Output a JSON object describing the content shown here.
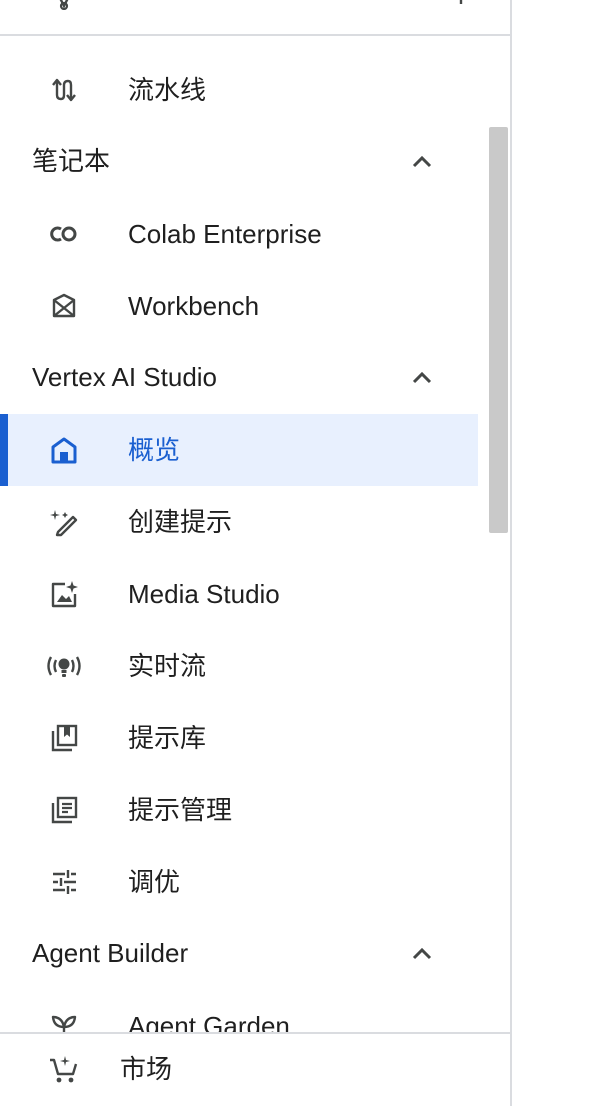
{
  "nav": {
    "pipelines_label": "流水线",
    "notebooks": {
      "title": "笔记本",
      "items": [
        {
          "label": "Colab Enterprise",
          "icon": "colab-icon"
        },
        {
          "label": "Workbench",
          "icon": "workbench-icon"
        }
      ]
    },
    "vertex_studio": {
      "title": "Vertex AI Studio",
      "items": [
        {
          "label": "概览",
          "icon": "home-icon",
          "active": true
        },
        {
          "label": "创建提示",
          "icon": "magic-pen-icon"
        },
        {
          "label": "Media Studio",
          "icon": "image-sparkle-icon"
        },
        {
          "label": "实时流",
          "icon": "live-stream-icon"
        },
        {
          "label": "提示库",
          "icon": "bookmark-library-icon"
        },
        {
          "label": "提示管理",
          "icon": "list-document-icon"
        },
        {
          "label": "调优",
          "icon": "tune-sliders-icon"
        }
      ]
    },
    "agent_builder": {
      "title": "Agent Builder",
      "items": [
        {
          "label": "Agent Garden",
          "icon": "sprout-icon"
        }
      ]
    }
  },
  "bottom": {
    "label": "市场",
    "icon": "shopping-cart-icon"
  },
  "colors": {
    "accent": "#1a5fd0",
    "active_bg": "#e8f0fe",
    "divider": "#dadce0",
    "icon": "#444746"
  }
}
